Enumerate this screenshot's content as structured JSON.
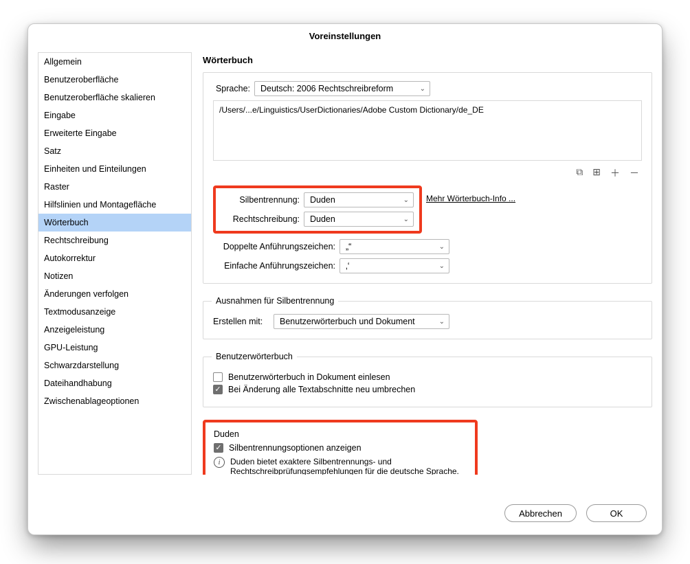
{
  "title": "Voreinstellungen",
  "sidebar": {
    "items": [
      {
        "label": "Allgemein"
      },
      {
        "label": "Benutzeroberfläche"
      },
      {
        "label": "Benutzeroberfläche skalieren"
      },
      {
        "label": "Eingabe"
      },
      {
        "label": "Erweiterte Eingabe"
      },
      {
        "label": "Satz"
      },
      {
        "label": "Einheiten und Einteilungen"
      },
      {
        "label": "Raster"
      },
      {
        "label": "Hilfslinien und Montagefläche"
      },
      {
        "label": "Wörterbuch"
      },
      {
        "label": "Rechtschreibung"
      },
      {
        "label": "Autokorrektur"
      },
      {
        "label": "Notizen"
      },
      {
        "label": "Änderungen verfolgen"
      },
      {
        "label": "Textmodusanzeige"
      },
      {
        "label": "Anzeigeleistung"
      },
      {
        "label": "GPU-Leistung"
      },
      {
        "label": "Schwarzdarstellung"
      },
      {
        "label": "Dateihandhabung"
      },
      {
        "label": "Zwischenablageoptionen"
      }
    ],
    "selected_index": 9
  },
  "main": {
    "heading": "Wörterbuch",
    "language_label": "Sprache:",
    "language_value": "Deutsch: 2006 Rechtschreibreform",
    "path_text": "/Users/...e/Linguistics/UserDictionaries/Adobe Custom Dictionary/de_DE",
    "more_info": "Mehr Wörterbuch-Info ...",
    "hyphenation_label": "Silbentrennung:",
    "hyphenation_value": "Duden",
    "spelling_label": "Rechtschreibung:",
    "spelling_value": "Duden",
    "double_quotes_label": "Doppelte Anführungszeichen:",
    "double_quotes_value": "„“",
    "single_quotes_label": "Einfache Anführungszeichen:",
    "single_quotes_value": "‚‘"
  },
  "exceptions": {
    "legend": "Ausnahmen für Silbentrennung",
    "compose_label": "Erstellen mit:",
    "compose_value": "Benutzerwörterbuch und Dokument"
  },
  "userdict": {
    "legend": "Benutzerwörterbuch",
    "merge_label": "Benutzerwörterbuch in Dokument einlesen",
    "recompose_label": "Bei Änderung alle Textabschnitte neu umbrechen"
  },
  "duden": {
    "legend": "Duden",
    "show_opts_label": "Silbentrennungsoptionen anzeigen",
    "info_text": "Duden bietet exaktere Silbentrennungs- und Rechtschreibprüfungsempfehlungen für die deutsche Sprache."
  },
  "buttons": {
    "cancel": "Abbrechen",
    "ok": "OK"
  }
}
